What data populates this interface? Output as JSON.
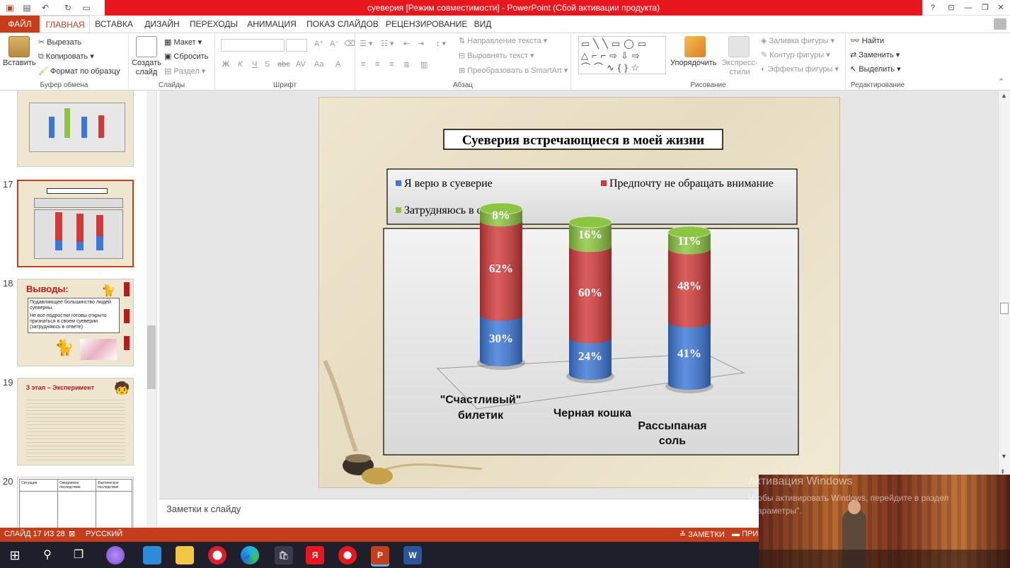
{
  "window": {
    "title": "суеверия [Режим совместимости] - PowerPoint (Сбой активации продукта)",
    "help": "?",
    "minimize": "—",
    "restore": "❐",
    "close": "✕"
  },
  "tabs": [
    "ФАЙЛ",
    "ГЛАВНАЯ",
    "ВСТАВКА",
    "ДИЗАЙН",
    "ПЕРЕХОДЫ",
    "АНИМАЦИЯ",
    "ПОКАЗ СЛАЙДОВ",
    "РЕЦЕНЗИРОВАНИЕ",
    "ВИД"
  ],
  "ribbon": {
    "paste": "Вставить",
    "cut": "Вырезать",
    "copy": "Копировать",
    "format_painter": "Формат по образцу",
    "clipboard_group": "Буфер обмена",
    "new_slide": "Создать слайд",
    "layout": "Макет",
    "reset": "Сбросить",
    "section": "Раздел",
    "slides_group": "Слайды",
    "font_group": "Шрифт",
    "text_direction": "Направление текста",
    "align_text": "Выровнять текст",
    "smartart": "Преобразовать в SmartArt",
    "paragraph_group": "Абзац",
    "arrange": "Упорядочить",
    "quick_styles": "Экспресс-стили",
    "shape_fill": "Заливка фигуры",
    "shape_outline": "Контур фигуры",
    "shape_effects": "Эффекты фигуры",
    "drawing_group": "Рисование",
    "find": "Найти",
    "replace": "Заменить",
    "select": "Выделить",
    "editing_group": "Редактирование",
    "font_buttons": [
      "Ж",
      "К",
      "Ч",
      "S",
      "abc",
      "AV",
      "Aa",
      "A"
    ]
  },
  "thumbs": {
    "n17": "17",
    "n18": "18",
    "n19": "19",
    "n20": "20",
    "t18_title": "Выводы:",
    "t18_line1": "Подавляющее большинство людей суеверны.",
    "t18_line2": "Не все подростки готовы открыто признаться в своем суеверии",
    "t18_line3": "(затрудняюсь в ответе)",
    "t19_title": "3 этап – Эксперимент",
    "t20_h1": "Ситуация",
    "t20_h2": "Ожидаемое последствие",
    "t20_h3": "Фактическое последствие"
  },
  "chart_data": {
    "type": "bar",
    "title": "Суеверия встречающиеся в моей жизни",
    "categories": [
      "\"Счастливый\" билетик",
      "Черная кошка",
      "Рассыпаная соль"
    ],
    "series": [
      {
        "name": "Я верю в суеверие",
        "values": [
          30,
          24,
          41
        ],
        "color": "#3c78d8"
      },
      {
        "name": "Предпочту не обращать внимание",
        "values": [
          62,
          60,
          48
        ],
        "color": "#d23a3a"
      },
      {
        "name": "Затрудняюсь в ответе",
        "values": [
          8,
          16,
          11
        ],
        "color": "#8cc540"
      }
    ],
    "stacked": true,
    "value_labels": [
      [
        "30%",
        "62%",
        "8%"
      ],
      [
        "24%",
        "60%",
        "16%"
      ],
      [
        "41%",
        "48%",
        "11%"
      ]
    ],
    "legend_position": "top",
    "grid": false
  },
  "notes_placeholder": "Заметки к слайду",
  "status": {
    "slide": "СЛАЙД 17 ИЗ 28",
    "language": "РУССКИЙ",
    "notes": "ЗАМЕТКИ",
    "comments": "ПРИМ"
  },
  "watermark": {
    "title": "Активация Windows",
    "text": "Чтобы активировать Windows, перейдите в раздел \"Параметры\"."
  },
  "colors": {
    "accent": "#c43e1c",
    "title_bar": "#e8161d",
    "taskbar": "#1f1f2b"
  }
}
